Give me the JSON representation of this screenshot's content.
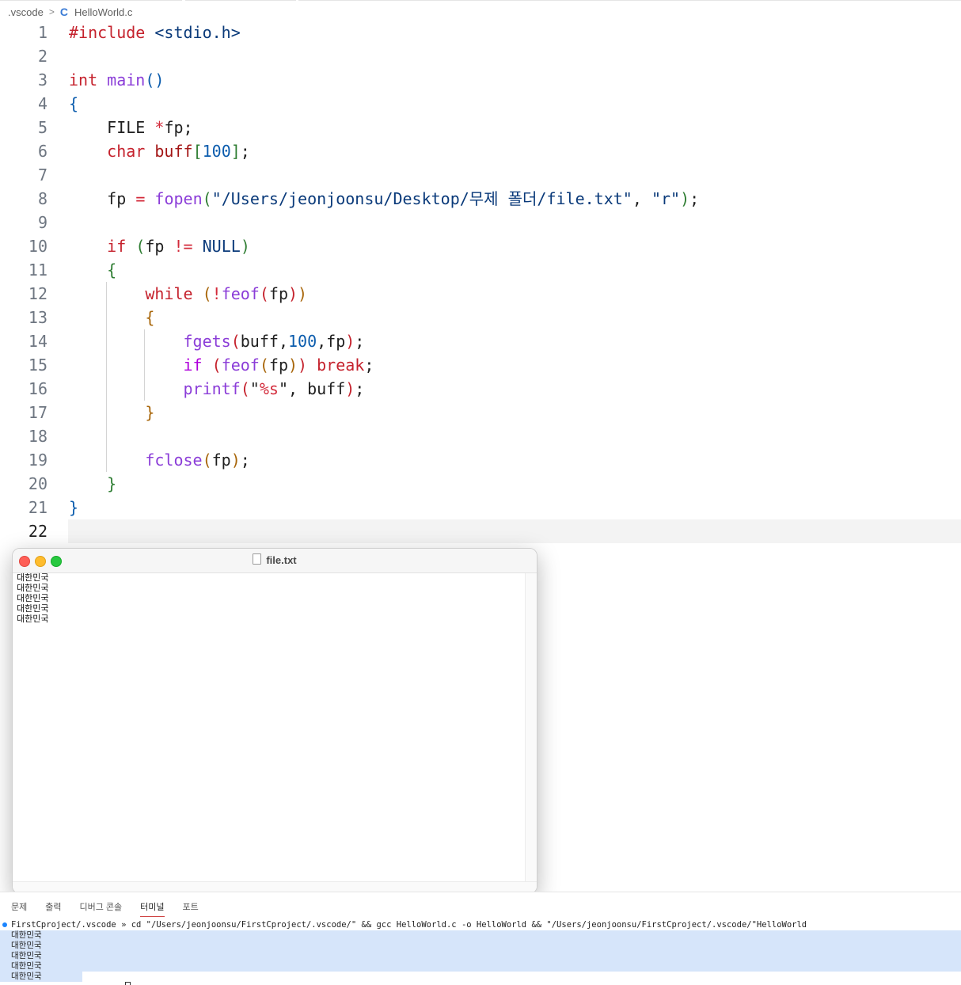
{
  "breadcrumb": {
    "folder": ".vscode",
    "file": "HelloWorld.c",
    "file_icon": "C"
  },
  "editor": {
    "lines": [
      {
        "num": "1"
      },
      {
        "num": "2"
      },
      {
        "num": "3"
      },
      {
        "num": "4"
      },
      {
        "num": "5"
      },
      {
        "num": "6"
      },
      {
        "num": "7"
      },
      {
        "num": "8"
      },
      {
        "num": "9"
      },
      {
        "num": "10"
      },
      {
        "num": "11"
      },
      {
        "num": "12"
      },
      {
        "num": "13"
      },
      {
        "num": "14"
      },
      {
        "num": "15"
      },
      {
        "num": "16"
      },
      {
        "num": "17"
      },
      {
        "num": "18"
      },
      {
        "num": "19"
      },
      {
        "num": "20"
      },
      {
        "num": "21"
      },
      {
        "num": "22"
      }
    ],
    "tokens": {
      "include": "#include",
      "header": "<stdio.h>",
      "int": "int",
      "main": "main",
      "file_type": "FILE",
      "star": "*",
      "fp": "fp",
      "char": "char",
      "buff": "buff",
      "hundred": "100",
      "fopen": "fopen",
      "path": "\"/Users/jeonjoonsu/Desktop/무제 폴더/file.txt\"",
      "mode": "\"r\"",
      "if": "if",
      "neq": "!=",
      "null": "NULL",
      "while": "while",
      "not": "!",
      "feof": "feof",
      "fgets": "fgets",
      "break": "break",
      "printf": "printf",
      "fmt_open": "\"",
      "fmt_spec": "%s",
      "fmt_close": "\"",
      "fclose": "fclose"
    }
  },
  "textedit_window": {
    "title": "file.txt",
    "lines": [
      "대한민국",
      "대한민국",
      "대한민국",
      "대한민국",
      "대한민국"
    ]
  },
  "panel": {
    "tabs": [
      "문제",
      "출력",
      "디버그 콘솔",
      "터미널",
      "포트"
    ],
    "active_tab": "터미널",
    "terminal": {
      "command": "FirstCproject/.vscode » cd \"/Users/jeonjoonsu/FirstCproject/.vscode/\" && gcc HelloWorld.c -o HelloWorld && \"/Users/jeonjoonsu/FirstCproject/.vscode/\"HelloWorld",
      "output": [
        "대한민국",
        "대한민국",
        "대한민국",
        "대한민국",
        "대한민국"
      ]
    }
  }
}
